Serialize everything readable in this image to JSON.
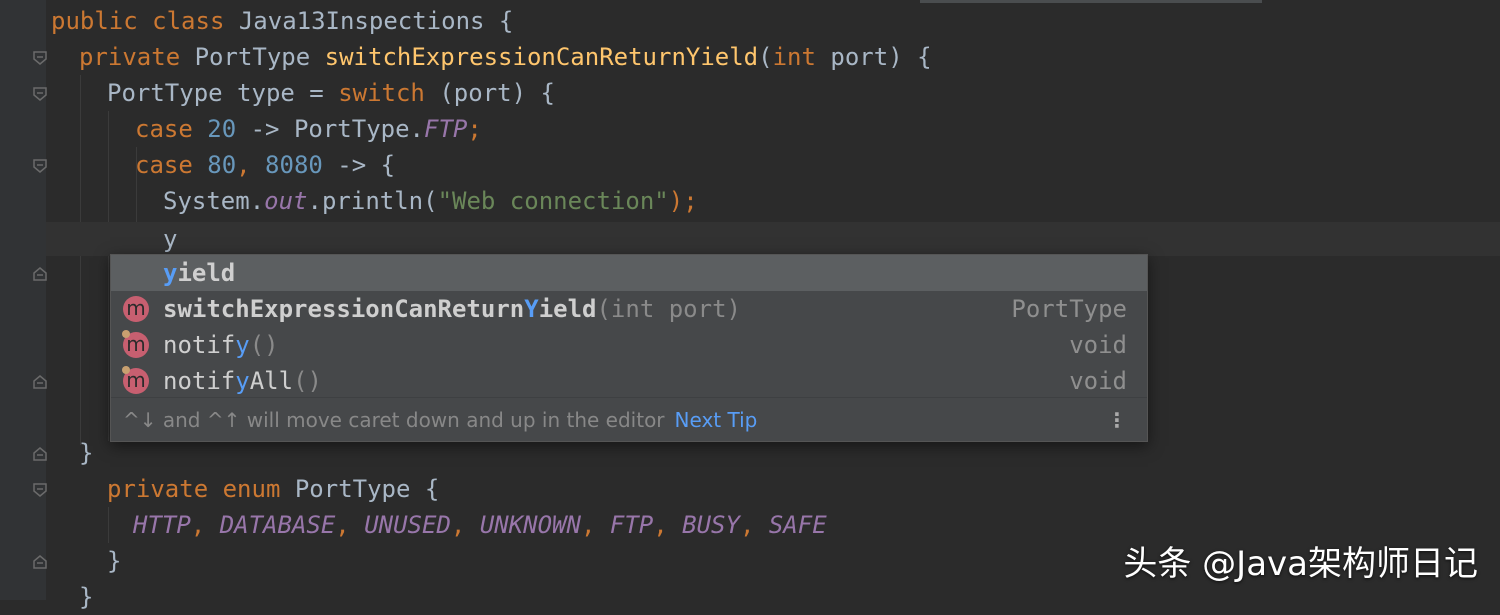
{
  "code": {
    "l1": {
      "kw": "public class",
      "rest": " Java13Inspections {"
    },
    "l2": {
      "kw": "private",
      "type": " PortType ",
      "fn": "switchExpressionCanReturnYield",
      "p1": "(",
      "kw2": "int",
      "p2": " port) {"
    },
    "l3": {
      "a": "PortType type = ",
      "kw": "switch",
      "b": " (port) {"
    },
    "l4": {
      "kw": "case",
      "num": " 20",
      "a": " -> PortType.",
      "field": "FTP",
      "b": ";"
    },
    "l5": {
      "kw": "case",
      "num1": " 80",
      "c": ",",
      "num2": " 8080",
      "a": " -> {"
    },
    "l6": {
      "a": "System.",
      "field": "out",
      "b": ".println(",
      "str": "\"Web connection\"",
      "c": ");"
    },
    "l7": {
      "a": "y"
    },
    "l8": {
      "a": "}"
    },
    "l9": {
      "kw": "private enum",
      "a": " PortType {"
    },
    "l10": {
      "field1": "HTTP",
      "s1": ", ",
      "field2": "DATABASE",
      "s2": ", ",
      "field3": "UNUSED",
      "s3": ", ",
      "field4": "UNKNOWN",
      "s4": ", ",
      "field5": "FTP",
      "s5": ", ",
      "field6": "BUSY",
      "s6": ", ",
      "field7": "SAFE"
    },
    "l11": {
      "a": "}"
    },
    "l12": {
      "a": "}"
    }
  },
  "completion": {
    "items": [
      {
        "pre": "",
        "hl": "y",
        "post": "ield",
        "params": "",
        "type": ""
      },
      {
        "icon": "m",
        "pre": "switchExpressionCanReturn",
        "hl": "Y",
        "post": "ield",
        "params": "(int port)",
        "type": "PortType"
      },
      {
        "icon": "m",
        "pre": "notif",
        "hl": "y",
        "post": "",
        "params": "()",
        "type": "void"
      },
      {
        "icon": "m",
        "pre": "notif",
        "hl": "y",
        "post": "All",
        "params": "()",
        "type": "void"
      }
    ],
    "hint": "^↓ and ^↑ will move caret down and up in the editor",
    "hint_link": "Next Tip",
    "more_icon": "⋮"
  },
  "watermark": "头条 @Java架构师日记"
}
